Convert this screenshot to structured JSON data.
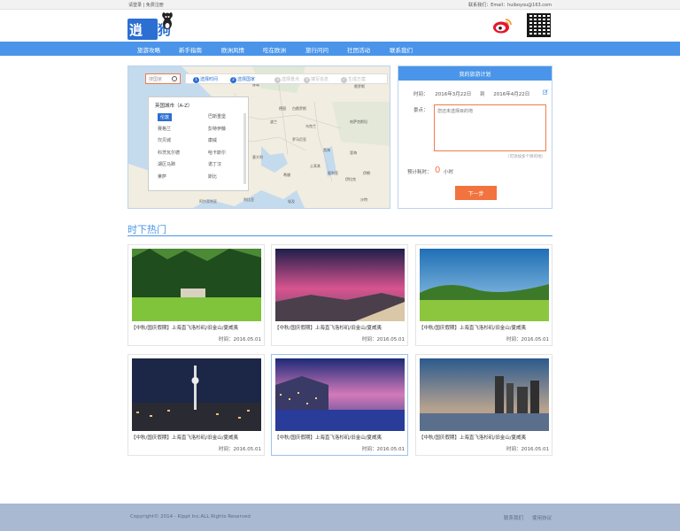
{
  "topbar": {
    "login": "请登录",
    "sep": "|",
    "register": "免费注册",
    "contact": "联系我们：Email：huiboyou@163.com"
  },
  "logo": {
    "part1": "逍",
    "part2": "遥狗"
  },
  "nav": [
    "旅游攻略",
    "新手指南",
    "欧洲风情",
    "吃在欧洲",
    "旅行问问",
    "社团活动",
    "联系我们"
  ],
  "map": {
    "search_placeholder": "搜国家",
    "steps": [
      {
        "num": "1",
        "label": "选择时间",
        "active": true
      },
      {
        "num": "2",
        "label": "选择国家",
        "active": true
      },
      {
        "num": "3",
        "label": "选择景点",
        "active": false
      },
      {
        "num": "4",
        "label": "填写信息",
        "active": false
      },
      {
        "num": "✓",
        "label": "生成方案",
        "active": false
      }
    ],
    "city_panel_title": "英国城市（A-Z）",
    "cities": [
      "伦敦",
      "巴斯重堡",
      "赛格兰",
      "彭特伊藤",
      "坎贝城",
      "康威",
      "科茨瓦尔德",
      "哈卡斯尔",
      "湖区马蹄",
      "诺丁汉",
      "莱萨",
      "斯比"
    ],
    "labels": [
      "俄罗斯",
      "德国",
      "法国",
      "英国",
      "波兰",
      "乌克兰",
      "白俄罗斯",
      "哈萨克斯坦",
      "土耳其",
      "伊朗",
      "伊拉克",
      "叙利亚",
      "埃及",
      "沙特",
      "利比亚",
      "阿尔及利亚",
      "西班牙",
      "意大利",
      "希腊",
      "罗马尼亚",
      "挪威",
      "瑞典",
      "芬兰",
      "黑海",
      "里海"
    ]
  },
  "planner": {
    "title": "我的旅游计划",
    "time_label": "时间：",
    "start": "2016年3月22日",
    "to": "到",
    "end": "2016年4月22日",
    "spots_label": "景点：",
    "spots_placeholder": "您还未选择目的地",
    "hint": "（可添加多个目的地）",
    "days_label": "预计耗时：",
    "days_value": "0",
    "days_unit": "小时",
    "next_button": "下一步"
  },
  "hot": {
    "title": "时下热门",
    "cards": [
      {
        "caption": "【中秋/国庆假期】上海直飞洛杉矶/旧金山/夏威夷",
        "time": "时间：2016.05.01"
      },
      {
        "caption": "【中秋/国庆假期】上海直飞洛杉矶/旧金山/夏威夷",
        "time": "时间：2016.05.01"
      },
      {
        "caption": "【中秋/国庆假期】上海直飞洛杉矶/旧金山/夏威夷",
        "time": "时间：2016.05.01"
      },
      {
        "caption": "【中秋/国庆假期】上海直飞洛杉矶/旧金山/夏威夷",
        "time": "时间：2016.05.01"
      },
      {
        "caption": "【中秋/国庆假期】上海直飞洛杉矶/旧金山/夏威夷",
        "time": "时间：2016.05.01"
      },
      {
        "caption": "【中秋/国庆假期】上海直飞洛杉矶/旧金山/夏威夷",
        "time": "时间：2016.05.01"
      }
    ]
  },
  "footer": {
    "copyright": "Copyright© 2014 - Klppt Inc.ALL Rights Reserved",
    "links": [
      "联系我们",
      "使用协议"
    ]
  },
  "colors": {
    "accent": "#4a95e9",
    "orange": "#f2733e",
    "footer": "#a9b9d2"
  }
}
